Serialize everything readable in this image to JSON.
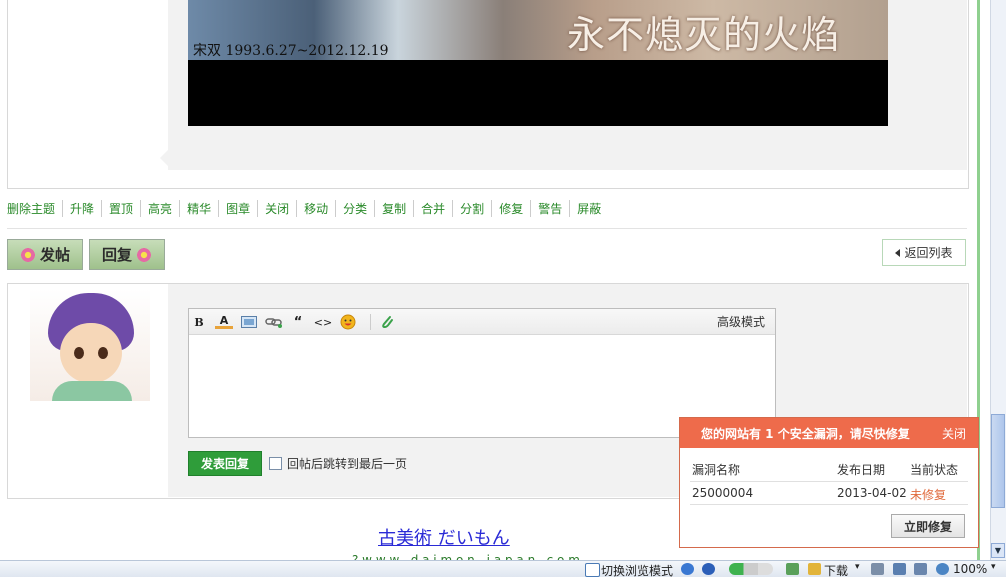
{
  "banner": {
    "date_text": "宋双  1993.6.27~2012.12.19",
    "title_text": "永不熄灭的火焰"
  },
  "moderation": {
    "links": [
      "删除主题",
      "升降",
      "置顶",
      "高亮",
      "精华",
      "图章",
      "关闭",
      "移动",
      "分类",
      "复制",
      "合并",
      "分割",
      "修复",
      "警告",
      "屏蔽"
    ]
  },
  "actions": {
    "new_post_label": "发帖",
    "reply_label": "回复",
    "back_to_list_label": "返回列表"
  },
  "editor": {
    "toolbar_icons": [
      "bold-icon",
      "font-color-icon",
      "image-icon",
      "link-icon",
      "quote-icon",
      "code-icon",
      "emoticon-icon",
      "attachment-icon"
    ],
    "bold_glyph": "B",
    "font_color_glyph": "A",
    "quote_glyph": "“",
    "code_glyph": "<>",
    "advanced_mode_label": "高级模式",
    "submit_label": "发表回复",
    "jump_option_label": "回帖后跳转到最后一页"
  },
  "footer": {
    "link_text": "古美術 だいもん",
    "url_text": "?  w w w . d a i m o n - j a p a n . c o m"
  },
  "security_popup": {
    "title": "您的网站有 1 个安全漏洞，请尽快修复",
    "close_label": "关闭",
    "columns": [
      "漏洞名称",
      "发布日期",
      "当前状态"
    ],
    "rows": [
      {
        "name": "25000004",
        "date": "2013-04-02",
        "status": "未修复"
      }
    ],
    "fix_button_label": "立即修复",
    "status_color": "#e06a3c",
    "header_color": "#ee6b4b"
  },
  "statusbar": {
    "browse_mode_label": "切换浏览模式",
    "download_label": "下载",
    "zoom_label": "100%"
  },
  "colors": {
    "link_green": "#2a8a2a",
    "submit_green": "#2f9d3a"
  }
}
